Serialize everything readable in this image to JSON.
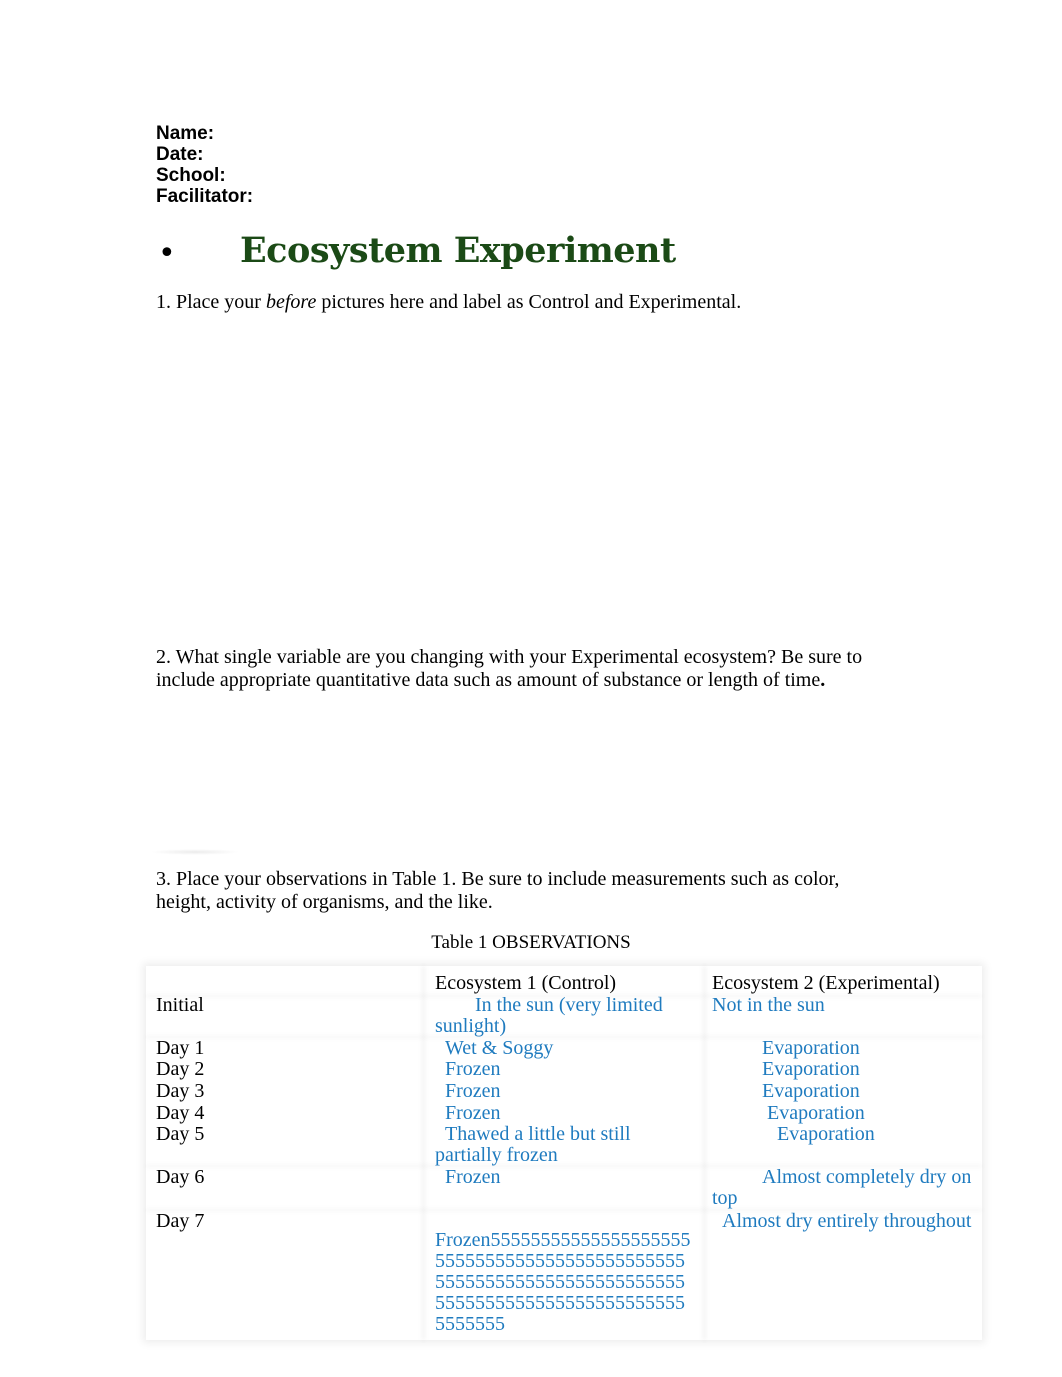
{
  "header_fields": {
    "name": "Name:",
    "date": "Date:",
    "school": "School:",
    "facilitator": "Facilitator:"
  },
  "title": {
    "bullet": "•",
    "text": "Ecosystem Experiment"
  },
  "questions": {
    "q1": {
      "prefix": "1. Place your ",
      "emphasis": "before",
      "suffix": " pictures here and label as Control and Experimental."
    },
    "q2": {
      "line1": "2. What single variable are you changing with your Experimental ecosystem?  Be sure to",
      "line2": "include appropriate quantitative data such as amount of substance or length of time",
      "end": "."
    },
    "q3": {
      "line1": "3. Place your observations in Table 1.  Be sure to include measurements such as color,",
      "line2": "height, activity of organisms, and the like."
    }
  },
  "table": {
    "caption": "Table 1 OBSERVATIONS",
    "headers": [
      "",
      "Ecosystem 1 (Control)",
      "Ecosystem 2 (Experimental)"
    ],
    "rows": [
      {
        "label": "Initial",
        "control": "        In the sun (very limited sunlight)",
        "experimental": "Not in the sun"
      },
      {
        "label": "Day 1",
        "control": "  Wet & Soggy",
        "experimental": "          Evaporation"
      },
      {
        "label": "Day 2",
        "control": "  Frozen",
        "experimental": "          Evaporation"
      },
      {
        "label": "Day 3",
        "control": "  Frozen",
        "experimental": "          Evaporation"
      },
      {
        "label": "Day 4",
        "control": "  Frozen",
        "experimental": "           Evaporation"
      },
      {
        "label": "Day 5",
        "control": "  Thawed a little but still partially frozen",
        "experimental": "             Evaporation"
      },
      {
        "label": "Day 6",
        "control": "  Frozen",
        "experimental": "          Almost completely dry on top"
      },
      {
        "label": "Day 7",
        "control": "Frozen555555555555555555555555555555555555555555555555555555555555555555555555555555555555555555555555555555",
        "experimental": "  Almost dry entirely throughout"
      }
    ]
  }
}
